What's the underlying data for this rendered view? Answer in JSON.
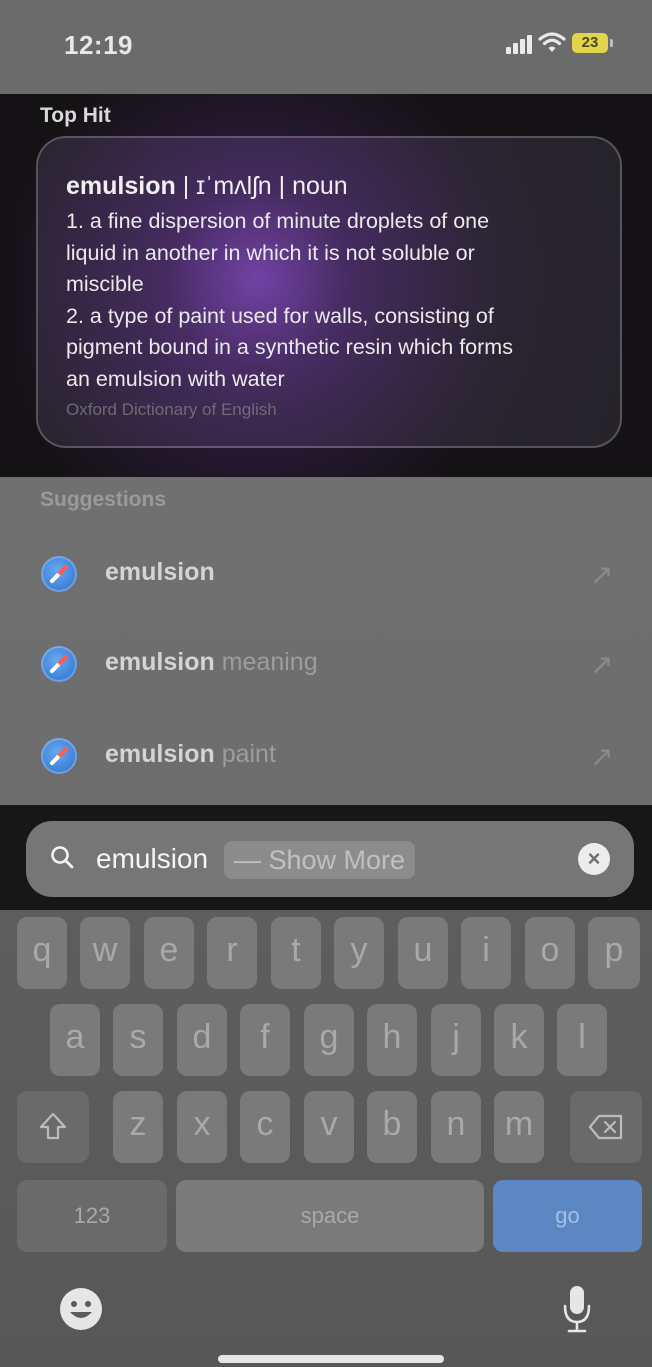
{
  "status_bar": {
    "time": "12:19",
    "battery": "23"
  },
  "top_hit": {
    "title": "Top Hit",
    "word": "emulsion",
    "pronunciation": " | ɪˈmʌlʃn | noun",
    "definition_lines": [
      "1. a fine dispersion of minute droplets of one",
      "liquid in another in which it is not soluble or",
      "miscible",
      "2. a type of paint used for walls, consisting of",
      "pigment bound in a synthetic resin which forms",
      "an emulsion with water"
    ],
    "source": "Oxford Dictionary of English"
  },
  "suggestions": {
    "title": "Suggestions",
    "items": [
      {
        "bold": "emulsion",
        "rest": ""
      },
      {
        "bold": "emulsion",
        "rest": " meaning"
      },
      {
        "bold": "emulsion",
        "rest": " paint"
      }
    ]
  },
  "search": {
    "value": "emulsion",
    "show_more": "— Show More"
  },
  "keyboard": {
    "row1": [
      "q",
      "w",
      "e",
      "r",
      "t",
      "y",
      "u",
      "i",
      "o",
      "p"
    ],
    "row2": [
      "a",
      "s",
      "d",
      "f",
      "g",
      "h",
      "j",
      "k",
      "l"
    ],
    "row3": [
      "z",
      "x",
      "c",
      "v",
      "b",
      "n",
      "m"
    ],
    "numbers_label": "123",
    "space_label": "space",
    "go_label": "go"
  },
  "icons": {
    "search": "search-icon",
    "clear": "clear-icon",
    "suggestion": "safari-compass-icon",
    "arrow": "arrow-up-left-icon",
    "shift": "shift-icon",
    "delete": "delete-icon",
    "emoji": "emoji-icon",
    "mic": "microphone-icon"
  }
}
